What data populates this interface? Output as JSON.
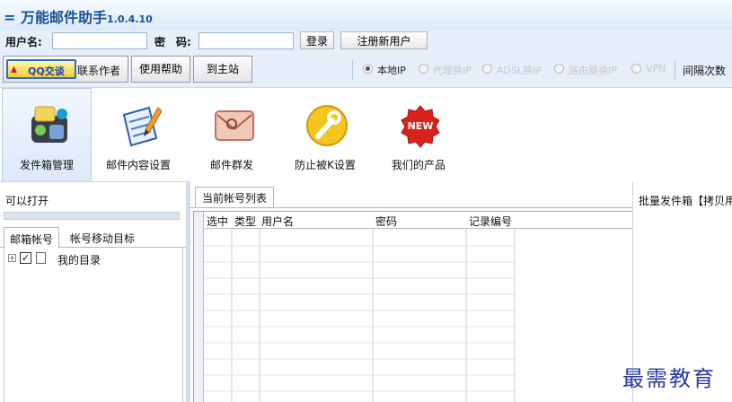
{
  "app": {
    "title": "万能邮件助手",
    "version": "1.0.4.10"
  },
  "login": {
    "username_label": "用户名:",
    "password_label": "密　码:",
    "username_value": "",
    "password_value": "",
    "login_button": "登录",
    "register_button": "注册新用户"
  },
  "toolbar": {
    "qq_badge": "QQ交谈",
    "qq_label": "联系作者",
    "help_button": "使用帮助",
    "site_button": "到主站",
    "ip_options": [
      {
        "label": "本地IP",
        "selected": true,
        "enabled": true
      },
      {
        "label": "代理换IP",
        "selected": false,
        "enabled": false
      },
      {
        "label": "ADSL换IP",
        "selected": false,
        "enabled": false
      },
      {
        "label": "路由器换IP",
        "selected": false,
        "enabled": false
      },
      {
        "label": "VPN",
        "selected": false,
        "enabled": false
      }
    ],
    "interval_label": "间隔次数"
  },
  "nav": [
    {
      "label": "发件箱管理",
      "icon": "mailbox-icon",
      "active": true
    },
    {
      "label": "邮件内容设置",
      "icon": "edit-document-icon",
      "active": false
    },
    {
      "label": "邮件群发",
      "icon": "envelope-icon",
      "active": false
    },
    {
      "label": "防止被K设置",
      "icon": "wrench-icon",
      "active": false
    },
    {
      "label": "我们的产品",
      "icon": "new-badge-icon",
      "active": false,
      "badge": "NEW"
    }
  ],
  "left": {
    "title": "可以打开",
    "tabs": [
      "邮箱帐号",
      "帐号移动目标"
    ],
    "tree": [
      {
        "label": "我的目录",
        "checked": true
      }
    ]
  },
  "middle": {
    "tab": "当前帐号列表",
    "columns": [
      "选中",
      "类型",
      "用户名",
      "密码",
      "记录编号"
    ]
  },
  "right": {
    "title": "批量发件箱【拷贝用"
  },
  "watermark": "最需教育",
  "colors": {
    "title": "#1c4f95",
    "toolbar_bg": "#e5eef9",
    "accent": "#2d6bd1"
  }
}
